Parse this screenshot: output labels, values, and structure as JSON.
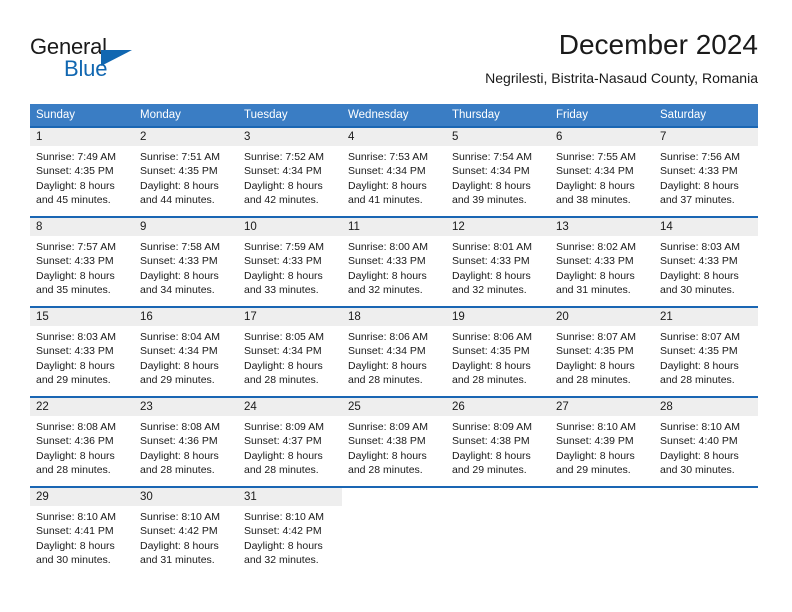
{
  "brand": {
    "word_one": "General",
    "word_two": "Blue",
    "flag_icon": "triangle-flag-icon"
  },
  "header": {
    "title": "December 2024",
    "subtitle": "Negrilesti, Bistrita-Nasaud County, Romania"
  },
  "calendar": {
    "weekday_headers": [
      "Sunday",
      "Monday",
      "Tuesday",
      "Wednesday",
      "Thursday",
      "Friday",
      "Saturday"
    ],
    "accent_color": "#3a7dc4",
    "separator_color": "#1a66b3",
    "daynum_band_color": "#eeeeee",
    "weeks": [
      [
        {
          "day": "1",
          "lines": [
            "Sunrise: 7:49 AM",
            "Sunset: 4:35 PM",
            "Daylight: 8 hours",
            "and 45 minutes."
          ]
        },
        {
          "day": "2",
          "lines": [
            "Sunrise: 7:51 AM",
            "Sunset: 4:35 PM",
            "Daylight: 8 hours",
            "and 44 minutes."
          ]
        },
        {
          "day": "3",
          "lines": [
            "Sunrise: 7:52 AM",
            "Sunset: 4:34 PM",
            "Daylight: 8 hours",
            "and 42 minutes."
          ]
        },
        {
          "day": "4",
          "lines": [
            "Sunrise: 7:53 AM",
            "Sunset: 4:34 PM",
            "Daylight: 8 hours",
            "and 41 minutes."
          ]
        },
        {
          "day": "5",
          "lines": [
            "Sunrise: 7:54 AM",
            "Sunset: 4:34 PM",
            "Daylight: 8 hours",
            "and 39 minutes."
          ]
        },
        {
          "day": "6",
          "lines": [
            "Sunrise: 7:55 AM",
            "Sunset: 4:34 PM",
            "Daylight: 8 hours",
            "and 38 minutes."
          ]
        },
        {
          "day": "7",
          "lines": [
            "Sunrise: 7:56 AM",
            "Sunset: 4:33 PM",
            "Daylight: 8 hours",
            "and 37 minutes."
          ]
        }
      ],
      [
        {
          "day": "8",
          "lines": [
            "Sunrise: 7:57 AM",
            "Sunset: 4:33 PM",
            "Daylight: 8 hours",
            "and 35 minutes."
          ]
        },
        {
          "day": "9",
          "lines": [
            "Sunrise: 7:58 AM",
            "Sunset: 4:33 PM",
            "Daylight: 8 hours",
            "and 34 minutes."
          ]
        },
        {
          "day": "10",
          "lines": [
            "Sunrise: 7:59 AM",
            "Sunset: 4:33 PM",
            "Daylight: 8 hours",
            "and 33 minutes."
          ]
        },
        {
          "day": "11",
          "lines": [
            "Sunrise: 8:00 AM",
            "Sunset: 4:33 PM",
            "Daylight: 8 hours",
            "and 32 minutes."
          ]
        },
        {
          "day": "12",
          "lines": [
            "Sunrise: 8:01 AM",
            "Sunset: 4:33 PM",
            "Daylight: 8 hours",
            "and 32 minutes."
          ]
        },
        {
          "day": "13",
          "lines": [
            "Sunrise: 8:02 AM",
            "Sunset: 4:33 PM",
            "Daylight: 8 hours",
            "and 31 minutes."
          ]
        },
        {
          "day": "14",
          "lines": [
            "Sunrise: 8:03 AM",
            "Sunset: 4:33 PM",
            "Daylight: 8 hours",
            "and 30 minutes."
          ]
        }
      ],
      [
        {
          "day": "15",
          "lines": [
            "Sunrise: 8:03 AM",
            "Sunset: 4:33 PM",
            "Daylight: 8 hours",
            "and 29 minutes."
          ]
        },
        {
          "day": "16",
          "lines": [
            "Sunrise: 8:04 AM",
            "Sunset: 4:34 PM",
            "Daylight: 8 hours",
            "and 29 minutes."
          ]
        },
        {
          "day": "17",
          "lines": [
            "Sunrise: 8:05 AM",
            "Sunset: 4:34 PM",
            "Daylight: 8 hours",
            "and 28 minutes."
          ]
        },
        {
          "day": "18",
          "lines": [
            "Sunrise: 8:06 AM",
            "Sunset: 4:34 PM",
            "Daylight: 8 hours",
            "and 28 minutes."
          ]
        },
        {
          "day": "19",
          "lines": [
            "Sunrise: 8:06 AM",
            "Sunset: 4:35 PM",
            "Daylight: 8 hours",
            "and 28 minutes."
          ]
        },
        {
          "day": "20",
          "lines": [
            "Sunrise: 8:07 AM",
            "Sunset: 4:35 PM",
            "Daylight: 8 hours",
            "and 28 minutes."
          ]
        },
        {
          "day": "21",
          "lines": [
            "Sunrise: 8:07 AM",
            "Sunset: 4:35 PM",
            "Daylight: 8 hours",
            "and 28 minutes."
          ]
        }
      ],
      [
        {
          "day": "22",
          "lines": [
            "Sunrise: 8:08 AM",
            "Sunset: 4:36 PM",
            "Daylight: 8 hours",
            "and 28 minutes."
          ]
        },
        {
          "day": "23",
          "lines": [
            "Sunrise: 8:08 AM",
            "Sunset: 4:36 PM",
            "Daylight: 8 hours",
            "and 28 minutes."
          ]
        },
        {
          "day": "24",
          "lines": [
            "Sunrise: 8:09 AM",
            "Sunset: 4:37 PM",
            "Daylight: 8 hours",
            "and 28 minutes."
          ]
        },
        {
          "day": "25",
          "lines": [
            "Sunrise: 8:09 AM",
            "Sunset: 4:38 PM",
            "Daylight: 8 hours",
            "and 28 minutes."
          ]
        },
        {
          "day": "26",
          "lines": [
            "Sunrise: 8:09 AM",
            "Sunset: 4:38 PM",
            "Daylight: 8 hours",
            "and 29 minutes."
          ]
        },
        {
          "day": "27",
          "lines": [
            "Sunrise: 8:10 AM",
            "Sunset: 4:39 PM",
            "Daylight: 8 hours",
            "and 29 minutes."
          ]
        },
        {
          "day": "28",
          "lines": [
            "Sunrise: 8:10 AM",
            "Sunset: 4:40 PM",
            "Daylight: 8 hours",
            "and 30 minutes."
          ]
        }
      ],
      [
        {
          "day": "29",
          "lines": [
            "Sunrise: 8:10 AM",
            "Sunset: 4:41 PM",
            "Daylight: 8 hours",
            "and 30 minutes."
          ]
        },
        {
          "day": "30",
          "lines": [
            "Sunrise: 8:10 AM",
            "Sunset: 4:42 PM",
            "Daylight: 8 hours",
            "and 31 minutes."
          ]
        },
        {
          "day": "31",
          "lines": [
            "Sunrise: 8:10 AM",
            "Sunset: 4:42 PM",
            "Daylight: 8 hours",
            "and 32 minutes."
          ]
        },
        {
          "day": "",
          "lines": []
        },
        {
          "day": "",
          "lines": []
        },
        {
          "day": "",
          "lines": []
        },
        {
          "day": "",
          "lines": []
        }
      ]
    ]
  }
}
